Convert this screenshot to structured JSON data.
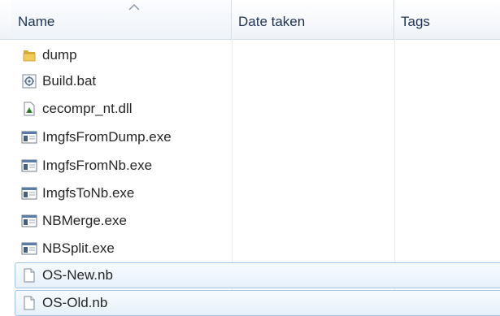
{
  "columns": {
    "name": "Name",
    "date_taken": "Date taken",
    "tags": "Tags"
  },
  "files": [
    {
      "name": "dump",
      "icon": "folder-icon",
      "selected": false
    },
    {
      "name": "Build.bat",
      "icon": "batch-file-icon",
      "selected": false
    },
    {
      "name": "cecompr_nt.dll",
      "icon": "dll-file-icon",
      "selected": false
    },
    {
      "name": "ImgfsFromDump.exe",
      "icon": "exe-file-icon",
      "selected": false
    },
    {
      "name": "ImgfsFromNb.exe",
      "icon": "exe-file-icon",
      "selected": false
    },
    {
      "name": "ImgfsToNb.exe",
      "icon": "exe-file-icon",
      "selected": false
    },
    {
      "name": "NBMerge.exe",
      "icon": "exe-file-icon",
      "selected": false
    },
    {
      "name": "NBSplit.exe",
      "icon": "exe-file-icon",
      "selected": false
    },
    {
      "name": "OS-New.nb",
      "icon": "generic-file-icon",
      "selected": true
    },
    {
      "name": "OS-Old.nb",
      "icon": "generic-file-icon",
      "selected": true
    }
  ]
}
